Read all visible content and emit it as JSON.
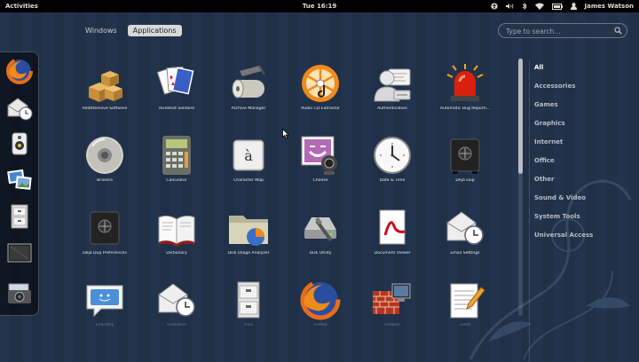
{
  "topbar": {
    "activities": "Activities",
    "clock": "Tue 16:19",
    "user": "James Watson"
  },
  "view_selector": {
    "windows": "Windows",
    "applications": "Applications"
  },
  "search": {
    "placeholder": "Type to search..."
  },
  "dash": [
    "firefox-icon",
    "mail-clock-icon",
    "speaker-icon",
    "photos-icon",
    "file-cabinet-icon",
    "screen-icon",
    "screenshot-camera-icon"
  ],
  "apps": [
    {
      "label": "Add/Remove Software",
      "icon": "boxes-icon"
    },
    {
      "label": "AisleRiot Solitaire",
      "icon": "playing-cards-icon"
    },
    {
      "label": "Archive Manager",
      "icon": "archive-roller-icon"
    },
    {
      "label": "Audio CD Extractor",
      "icon": "audio-cd-icon"
    },
    {
      "label": "Authentication",
      "icon": "authentication-icon"
    },
    {
      "label": "Automatic Bug Reporti...",
      "icon": "alarm-beacon-icon"
    },
    {
      "label": "Brasero",
      "icon": "disc-icon"
    },
    {
      "label": "Calculator",
      "icon": "calculator-icon"
    },
    {
      "label": "Character Map",
      "icon": "character-map-icon"
    },
    {
      "label": "Cheese",
      "icon": "webcam-icon"
    },
    {
      "label": "Date & Time",
      "icon": "clock-icon"
    },
    {
      "label": "Déjà Dup",
      "icon": "safe-icon"
    },
    {
      "label": "Déjà Dup Preferences",
      "icon": "safe-preferences-icon"
    },
    {
      "label": "Dictionary",
      "icon": "dictionary-icon"
    },
    {
      "label": "Disk Usage Analyzer",
      "icon": "disk-usage-icon"
    },
    {
      "label": "Disk Utility",
      "icon": "disk-utility-icon"
    },
    {
      "label": "Document Viewer",
      "icon": "document-viewer-icon"
    },
    {
      "label": "Email Settings",
      "icon": "email-settings-icon"
    },
    {
      "label": "Empathy",
      "icon": "chat-bubble-icon"
    },
    {
      "label": "Evolution",
      "icon": "mail-clock-icon"
    },
    {
      "label": "Files",
      "icon": "file-cabinet-icon"
    },
    {
      "label": "Firefox",
      "icon": "firefox-icon"
    },
    {
      "label": "Firewall",
      "icon": "firewall-icon"
    },
    {
      "label": "Gedit",
      "icon": "text-editor-icon"
    }
  ],
  "categories": [
    "All",
    "Accessories",
    "Games",
    "Graphics",
    "Internet",
    "Office",
    "Other",
    "Sound & Video",
    "System Tools",
    "Universal Access"
  ]
}
